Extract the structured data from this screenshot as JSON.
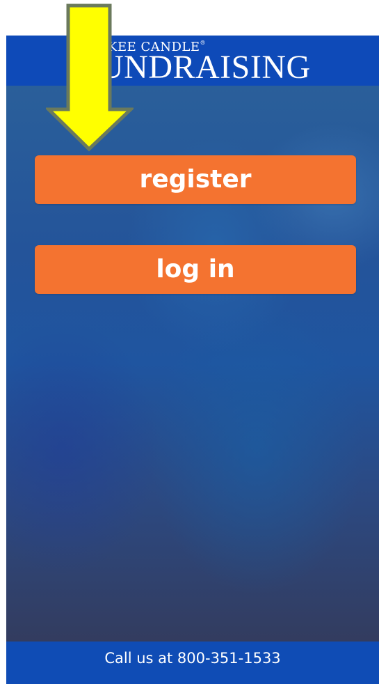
{
  "header": {
    "brand_line1": "KEE CANDLE",
    "brand_trademark": "®",
    "brand_line2": "UNDRAISING"
  },
  "actions": {
    "register_label": "register",
    "login_label": "log in"
  },
  "footer": {
    "call_text": "Call us at 800-351-1533"
  },
  "colors": {
    "header_blue": "#0e4ab8",
    "button_orange": "#f47330",
    "annotation_arrow": "#ffff00",
    "arrow_outline": "#6b7a5c"
  },
  "icons": {
    "annotation": "down-arrow-icon"
  }
}
